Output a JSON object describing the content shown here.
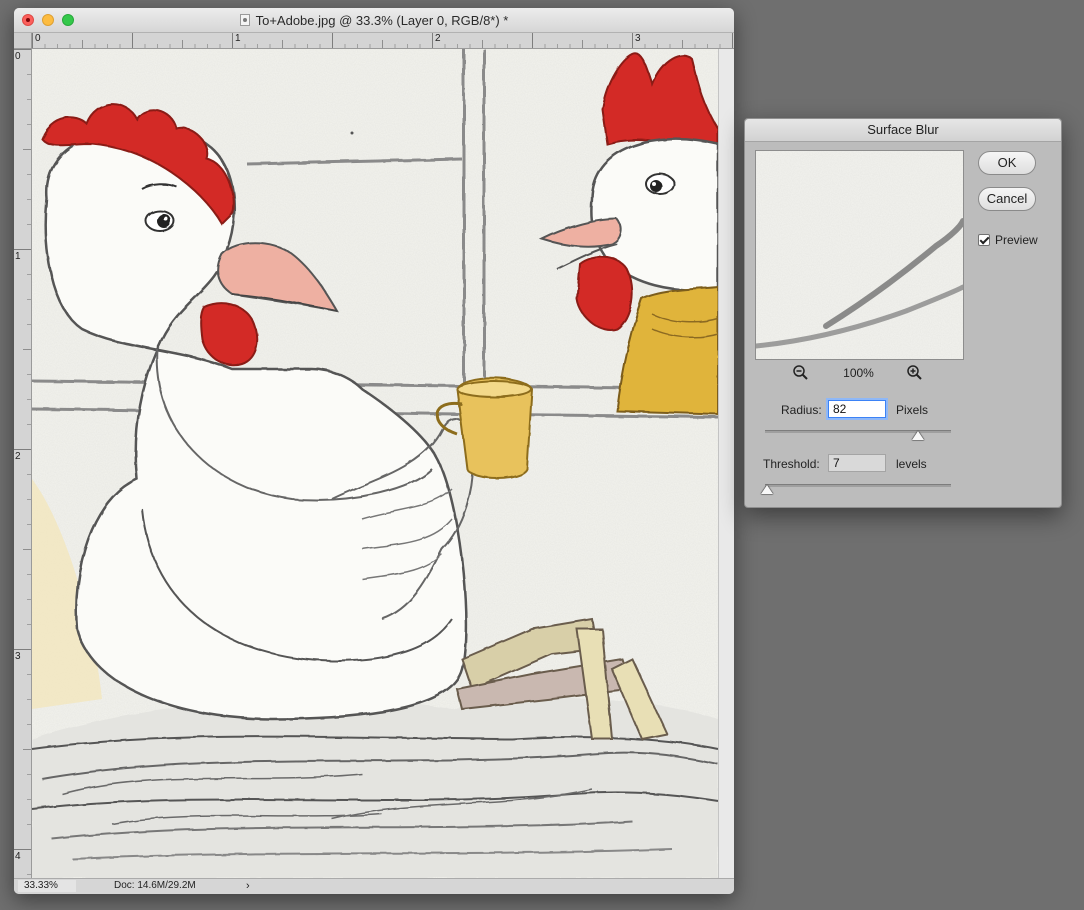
{
  "document": {
    "title": "To+Adobe.jpg @ 33.3% (Layer 0, RGB/8*) *",
    "ruler_h": [
      "0",
      "1",
      "2",
      "3"
    ],
    "ruler_v": [
      "0",
      "1",
      "2",
      "3",
      "4"
    ],
    "status": {
      "zoom": "33.33%",
      "doc_info": "Doc: 14.6M/29.2M",
      "arrow": "›"
    }
  },
  "dialog": {
    "title": "Surface Blur",
    "ok_label": "OK",
    "cancel_label": "Cancel",
    "preview_label": "Preview",
    "preview_checked": true,
    "zoom_percent": "100%",
    "radius": {
      "label": "Radius:",
      "value": "82",
      "unit": "Pixels",
      "slider_fraction": 0.82
    },
    "threshold": {
      "label": "Threshold:",
      "value": "7",
      "unit": "levels",
      "slider_fraction": 0.0
    }
  },
  "icons": [
    "proxy-document-icon",
    "zoom-out-icon",
    "zoom-in-icon"
  ],
  "colors": {
    "comb_red": "#d32a26",
    "beak_pink": "#eeb0a2",
    "mug_yellow": "#e8c25c",
    "sweater_yellow": "#e0b43a",
    "paper": "#f3f3ee",
    "pencil": "#4a4a4a"
  }
}
